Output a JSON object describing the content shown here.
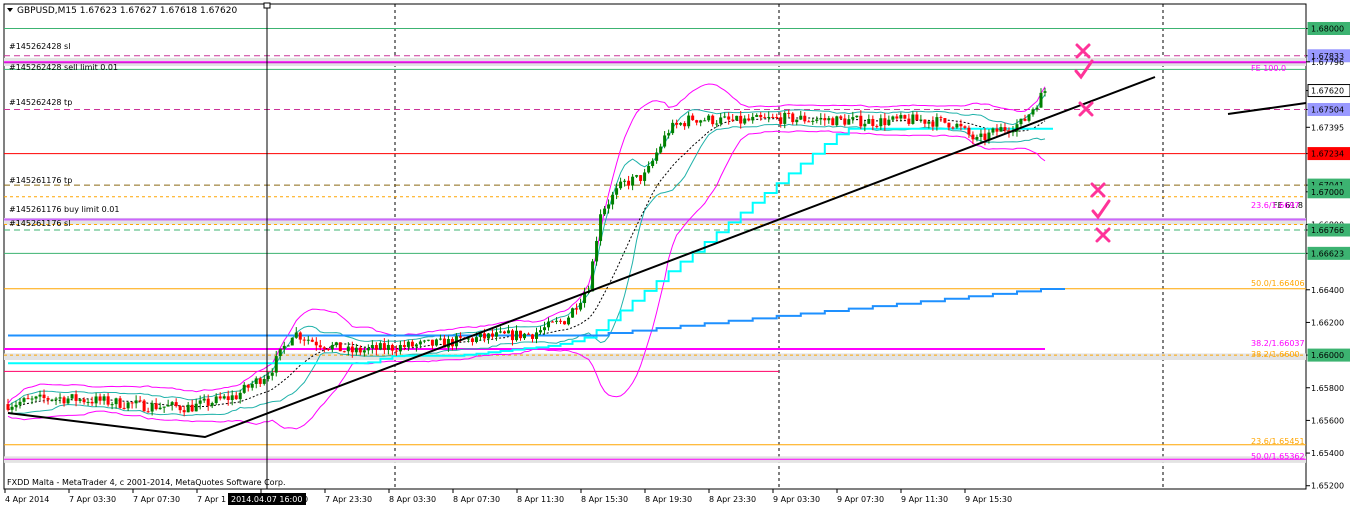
{
  "symbol_header": "GBPUSD,M15  1.67623 1.67627 1.67618 1.67620",
  "footer_text": "FXDD Malta - MetaTrader 4, c 2001-2014, MetaQuotes Software Corp.",
  "time_cursor_label": "2014.04.07 16:00",
  "colors": {
    "bull_candle": "#008000",
    "bear_candle": "#ff0000",
    "hline_green": "#3cb371",
    "fib_orange": "#ffa500",
    "magenta": "#ff00ff",
    "cyan_line": "#00ffff",
    "blue_line": "#1e90ff",
    "marker_pink": "#ff3399"
  },
  "order_labels": [
    "#145262428 sl",
    "#145262428 sell limit 0.01",
    "#145262428 tp",
    "#145261176 tp",
    "#145261176 buy limit 0.01",
    "#145261176 sl"
  ],
  "fib_labels": {
    "fe1000": "FE 100.0",
    "fe618": "FE 61.8",
    "f236a": "23.6/1.6697",
    "f500": "50.0/1.66406",
    "f382": "38.2/1.66037",
    "f382b": "38.2/1.6600",
    "f236b": "23.6/1.65451",
    "f500b": "50.0/1.65362"
  },
  "chart_data": {
    "type": "candlestick",
    "symbol": "GBPUSD",
    "timeframe": "M15",
    "ohlc_last": {
      "open": 1.67623,
      "high": 1.67627,
      "low": 1.67618,
      "close": 1.6762
    },
    "ylim": [
      1.6518,
      1.6815
    ],
    "price_ticks": [
      "1.68000",
      "1.67833",
      "1.67796",
      "1.67620",
      "1.67395",
      "1.67504",
      "1.67234",
      "1.67041",
      "1.67000",
      "1.66800",
      "1.66766",
      "1.66623",
      "1.66400",
      "1.66200",
      "1.66000",
      "1.65800",
      "1.65600",
      "1.65400",
      "1.65200"
    ],
    "highlighted_price_tags": [
      {
        "label": "1.68000",
        "color": "#3cb371"
      },
      {
        "label": "1.67833",
        "color": "#9999ff"
      },
      {
        "label": "1.67620",
        "color": "#ffffff"
      },
      {
        "label": "1.67504",
        "color": "#9999ff"
      },
      {
        "label": "1.67234",
        "color": "#ff0000"
      },
      {
        "label": "1.67041",
        "color": "#3cb371"
      },
      {
        "label": "1.67000",
        "color": "#3cb371"
      },
      {
        "label": "1.66766",
        "color": "#3cb371"
      },
      {
        "label": "1.66623",
        "color": "#3cb371"
      },
      {
        "label": "1.66000",
        "color": "#3cb371"
      }
    ],
    "time_ticks": [
      "4 Apr 2014",
      "7 Apr 03:30",
      "7 Apr 07:30",
      "7 Apr 1",
      "7 Apr 19:30",
      "7 Apr 23:30",
      "8 Apr 03:30",
      "8 Apr 07:30",
      "8 Apr 11:30",
      "8 Apr 15:30",
      "8 Apr 19:30",
      "8 Apr 23:30",
      "9 Apr 03:30",
      "9 Apr 07:30",
      "9 Apr 11:30",
      "9 Apr 15:30"
    ],
    "price_path": [
      {
        "t": 0,
        "p": 1.657
      },
      {
        "t": 4,
        "p": 1.6574
      },
      {
        "t": 8,
        "p": 1.6572
      },
      {
        "t": 12,
        "p": 1.6569
      },
      {
        "t": 16,
        "p": 1.6568
      },
      {
        "t": 20,
        "p": 1.6575
      },
      {
        "t": 23,
        "p": 1.659
      },
      {
        "t": 24,
        "p": 1.6602
      },
      {
        "t": 25,
        "p": 1.6614
      },
      {
        "t": 27,
        "p": 1.6608
      },
      {
        "t": 30,
        "p": 1.6602
      },
      {
        "t": 34,
        "p": 1.6605
      },
      {
        "t": 38,
        "p": 1.6607
      },
      {
        "t": 42,
        "p": 1.6611
      },
      {
        "t": 46,
        "p": 1.6613
      },
      {
        "t": 49,
        "p": 1.6622
      },
      {
        "t": 51,
        "p": 1.6643
      },
      {
        "t": 52,
        "p": 1.6688
      },
      {
        "t": 54,
        "p": 1.6705
      },
      {
        "t": 56,
        "p": 1.671
      },
      {
        "t": 57,
        "p": 1.6725
      },
      {
        "t": 58,
        "p": 1.6738
      },
      {
        "t": 60,
        "p": 1.6745
      },
      {
        "t": 64,
        "p": 1.6743
      },
      {
        "t": 68,
        "p": 1.6745
      },
      {
        "t": 72,
        "p": 1.6744
      },
      {
        "t": 76,
        "p": 1.6743
      },
      {
        "t": 80,
        "p": 1.6744
      },
      {
        "t": 83,
        "p": 1.6742
      },
      {
        "t": 85,
        "p": 1.6731
      },
      {
        "t": 87,
        "p": 1.6738
      },
      {
        "t": 89,
        "p": 1.6742
      },
      {
        "t": 90,
        "p": 1.6752
      },
      {
        "t": 91,
        "p": 1.6762
      }
    ]
  }
}
